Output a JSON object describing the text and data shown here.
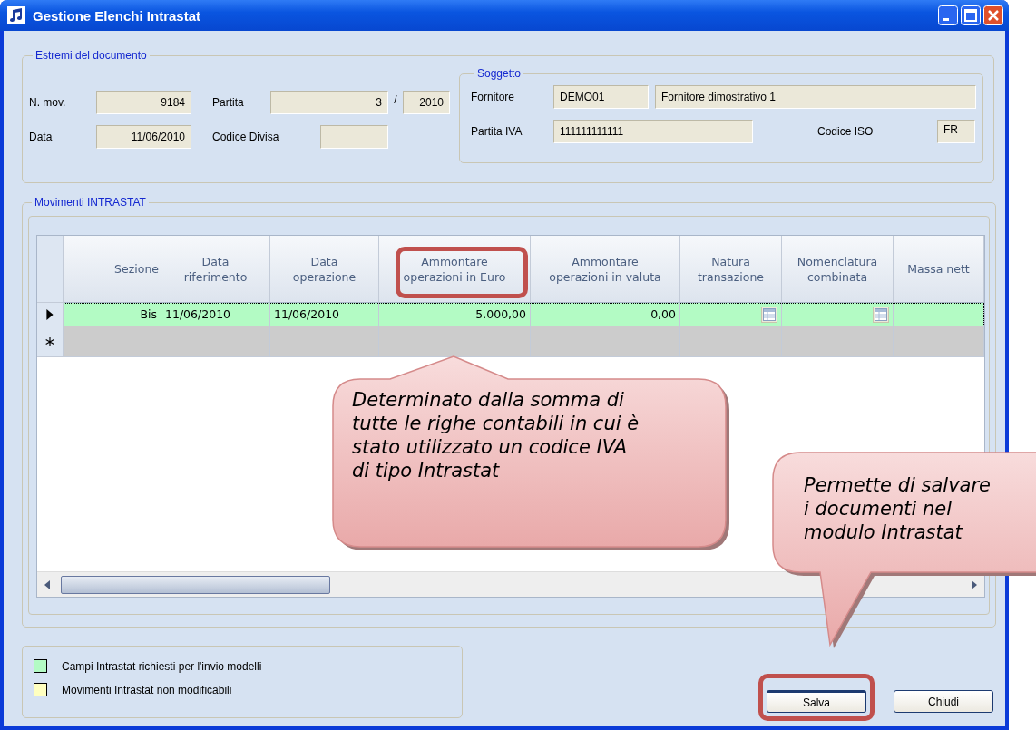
{
  "window": {
    "title": "Gestione Elenchi Intrastat"
  },
  "document": {
    "legend": "Estremi del documento",
    "n_mov_label": "N. mov.",
    "n_mov": "9184",
    "partita_label": "Partita",
    "partita": "3",
    "separator": "/",
    "partita_year": "2010",
    "data_label": "Data",
    "data": "11/06/2010",
    "codice_divisa_label": "Codice Divisa"
  },
  "subject": {
    "legend": "Soggetto",
    "fornitore_label": "Fornitore",
    "fornitore_code": "DEMO01",
    "fornitore_name": "Fornitore dimostrativo 1",
    "partita_iva_label": "Partita IVA",
    "partita_iva": "111111111111",
    "codice_iso_label": "Codice ISO",
    "codice_iso": "FR"
  },
  "movements": {
    "legend": "Movimenti INTRASTAT",
    "columns": [
      {
        "lines": [
          "Sezione"
        ],
        "highlighted": false
      },
      {
        "lines": [
          "Data",
          "riferimento"
        ],
        "highlighted": false
      },
      {
        "lines": [
          "Data",
          "operazione"
        ],
        "highlighted": false
      },
      {
        "lines": [
          "Ammontare",
          "operazioni in Euro"
        ],
        "highlighted": true
      },
      {
        "lines": [
          "Ammontare",
          "operazioni in valuta"
        ],
        "highlighted": false
      },
      {
        "lines": [
          "Natura",
          "transazione"
        ],
        "highlighted": false
      },
      {
        "lines": [
          "Nomenclatura",
          "combinata"
        ],
        "highlighted": false
      },
      {
        "lines": [
          "Massa nett"
        ],
        "highlighted": false
      }
    ],
    "rows": [
      {
        "kind": "current",
        "color": "#b3fbc4",
        "cells": [
          {
            "text": "Bis",
            "picker": false
          },
          {
            "text": "11/06/2010",
            "picker": false
          },
          {
            "text": "11/06/2010",
            "picker": false
          },
          {
            "text": "5.000,00",
            "picker": false
          },
          {
            "text": "0,00",
            "picker": false
          },
          {
            "picker": true
          },
          {
            "picker": true
          },
          {
            "picker": false
          }
        ]
      },
      {
        "kind": "new",
        "color": "#cccccc"
      }
    ]
  },
  "legend_items": [
    {
      "color": "#b3fbc4",
      "label": "Campi Intrastat richiesti per l'invio modelli"
    },
    {
      "color": "#ffffc0",
      "label": "Movimenti Intrastat non modificabili"
    }
  ],
  "buttons": [
    {
      "label": "Salva",
      "highlighted": true
    },
    {
      "label": "Chiudi",
      "highlighted": false
    }
  ],
  "callouts": [
    {
      "kind": "column-note",
      "text": "Determinato dalla somma di tutte le righe contabili in cui è stato utilizzato un codice IVA di tipo Intrastat"
    },
    {
      "kind": "button-note",
      "text": "Permette di salvare i documenti nel modulo Intrastat"
    }
  ]
}
